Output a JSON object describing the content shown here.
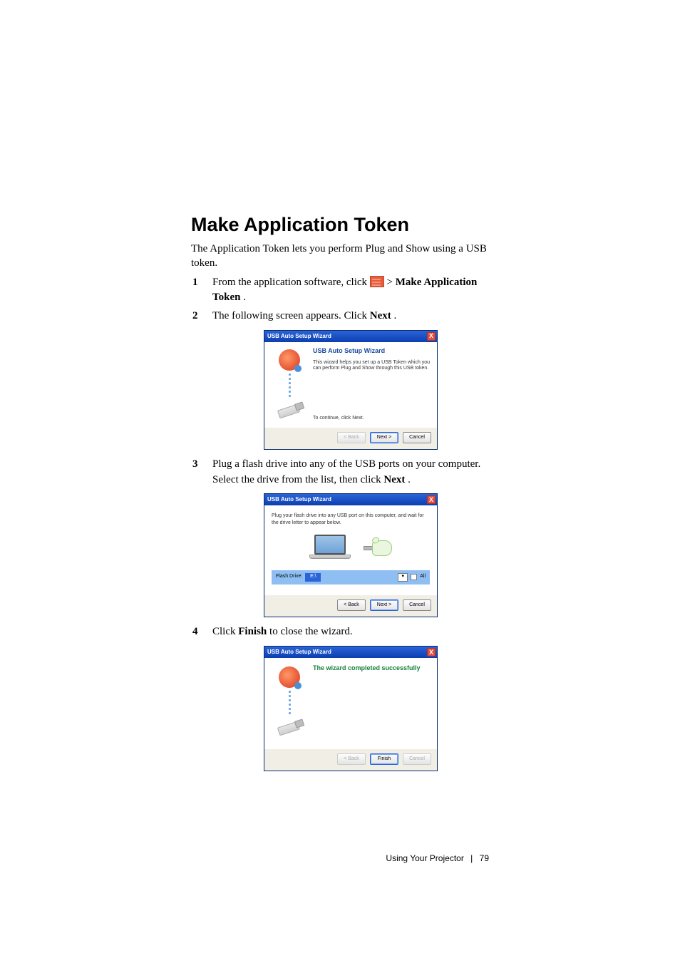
{
  "heading": "Make Application Token",
  "intro": "The Application Token lets you perform Plug and Show using a USB token.",
  "steps": {
    "s1": {
      "num": "1",
      "pre": "From the application software, click ",
      "icon_name": "menu-icon",
      "post1": " > ",
      "bold1": "Make Application Token",
      "post2": "."
    },
    "s2": {
      "num": "2",
      "pre": "The following screen appears. Click ",
      "bold1": "Next",
      "post1": "."
    },
    "s3": {
      "num": "3",
      "pre": "Plug a flash drive into any of the USB ports on your computer. Select the drive from the list, then click ",
      "bold1": "Next",
      "post1": "."
    },
    "s4": {
      "num": "4",
      "pre": "Click ",
      "bold1": "Finish",
      "post1": " to close the wizard."
    }
  },
  "wizard1": {
    "title": "USB Auto Setup Wizard",
    "heading": "USB Auto Setup Wizard",
    "desc": "This wizard helps you set up a USB Token which you can perform Plug and Show through this USB token.",
    "cont": "To continue, click Next.",
    "btn_back": "< Back",
    "btn_next": "Next >",
    "btn_cancel": "Cancel",
    "close": "X"
  },
  "wizard2": {
    "title": "USB Auto Setup Wizard",
    "desc": "Plug your flash drive into any USB port on this computer, and wait for the drive letter to appear below.",
    "flash_label": "Flash Drive:",
    "selected": "E:\\",
    "dd": "▼",
    "all": "All",
    "btn_back": "< Back",
    "btn_next": "Next >",
    "btn_cancel": "Cancel",
    "close": "X"
  },
  "wizard3": {
    "title": "USB Auto Setup Wizard",
    "done": "The wizard completed successfully",
    "btn_back": "< Back",
    "btn_finish": "Finish",
    "btn_cancel": "Cancel",
    "close": "X"
  },
  "footer": {
    "label": "Using Your Projector",
    "page": "79"
  }
}
